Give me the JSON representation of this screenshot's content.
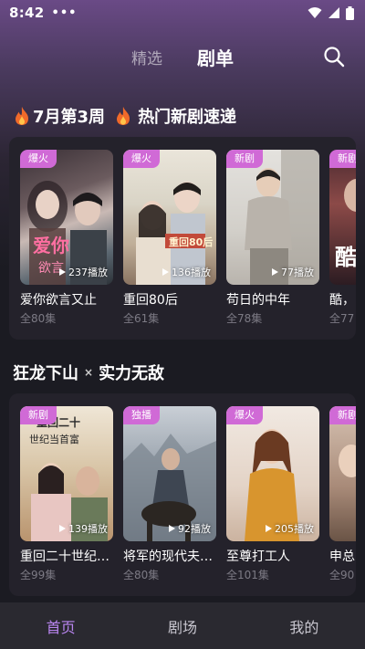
{
  "status": {
    "time": "8:42",
    "dots": "•••"
  },
  "header": {
    "tabs": [
      {
        "label": "精选"
      },
      {
        "label": "剧单"
      }
    ],
    "active_tab": "剧单",
    "search_icon": "search-icon"
  },
  "sections": [
    {
      "title_part1": "7月第3周",
      "title_part2": "热门新剧速递",
      "items": [
        {
          "badge": "爆火",
          "plays": "237播放",
          "title": "爱你欲言又止",
          "episodes": "全80集"
        },
        {
          "badge": "爆火",
          "plays": "136播放",
          "title": "重回80后",
          "episodes": "全61集"
        },
        {
          "badge": "新剧",
          "plays": "77播放",
          "title": "苟日的中年",
          "episodes": "全78集"
        },
        {
          "badge": "新剧",
          "plays": "",
          "title": "酷，",
          "episodes": "全77"
        }
      ]
    },
    {
      "title_part1": "狂龙下山",
      "title_sep": "×",
      "title_part2": "实力无敌",
      "items": [
        {
          "badge": "新剧",
          "plays": "139播放",
          "title": "重回二十世纪…",
          "episodes": "全99集"
        },
        {
          "badge": "独播",
          "plays": "92播放",
          "title": "将军的现代夫…",
          "episodes": "全80集"
        },
        {
          "badge": "爆火",
          "plays": "205播放",
          "title": "至尊打工人",
          "episodes": "全101集"
        },
        {
          "badge": "新剧",
          "plays": "",
          "title": "申总",
          "episodes": "全90"
        }
      ]
    }
  ],
  "bottom_nav": [
    {
      "label": "首页"
    },
    {
      "label": "剧场"
    },
    {
      "label": "我的"
    }
  ],
  "active_nav": "首页",
  "colors": {
    "accent": "#b985f0",
    "badge": "#d06ad6",
    "background": "#1b1b22"
  }
}
